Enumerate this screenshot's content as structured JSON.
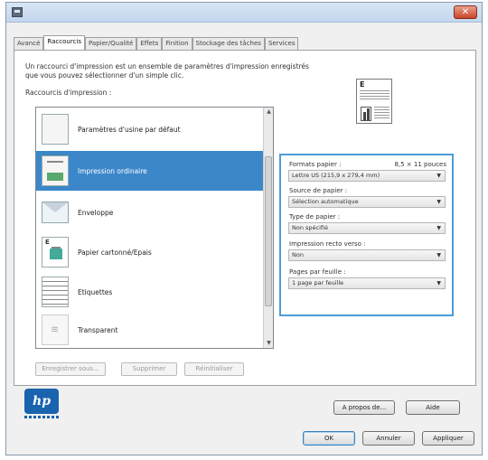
{
  "window": {
    "close_label": "✕"
  },
  "tabs": [
    {
      "label": "Avancé"
    },
    {
      "label": "Raccourcis"
    },
    {
      "label": "Papier/Qualité"
    },
    {
      "label": "Effets"
    },
    {
      "label": "Finition"
    },
    {
      "label": "Stockage des tâches"
    },
    {
      "label": "Services"
    }
  ],
  "shortcuts": {
    "description": "Un raccourci d'impression est un ensemble de paramètres d'impression enregistrés que vous pouvez sélectionner d'un simple clic.",
    "list_label": "Raccourcis d'impression :",
    "items": [
      {
        "label": "Paramètres d'usine par défaut",
        "icon": "blank-page-icon"
      },
      {
        "label": "Impression ordinaire",
        "icon": "document-photo-icon",
        "selected": true
      },
      {
        "label": "Enveloppe",
        "icon": "envelope-icon"
      },
      {
        "label": "Papier cartonné/Epais",
        "icon": "document-lines-icon"
      },
      {
        "label": "Etiquettes",
        "icon": "labels-icon"
      },
      {
        "label": "Transparent",
        "icon": "transparency-icon"
      }
    ],
    "buttons": {
      "save_as": "Enregistrer sous...",
      "delete": "Supprimer",
      "reset": "Réinitialiser"
    }
  },
  "settings": {
    "paper_size": {
      "label": "Formats papier :",
      "value": "Lettre US (215,9 x 279,4 mm)",
      "size_note": "8,5 × 11 pouces"
    },
    "paper_source": {
      "label": "Source de papier :",
      "value": "Sélection automatique"
    },
    "paper_type": {
      "label": "Type de papier :",
      "value": "Non spécifié"
    },
    "duplex": {
      "label": "Impression recto verso :",
      "value": "Non"
    },
    "pages_per_sheet": {
      "label": "Pages par feuille :",
      "value": "1 page par feuille"
    }
  },
  "brand": {
    "logo_text": "hp",
    "logo_color": "#1a63ae"
  },
  "footer": {
    "about": "A propos de...",
    "help": "Aide",
    "ok": "OK",
    "cancel": "Annuler",
    "apply": "Appliquer"
  },
  "colors": {
    "selection": "#3b87c9",
    "highlight_border": "#4d9bd6"
  }
}
